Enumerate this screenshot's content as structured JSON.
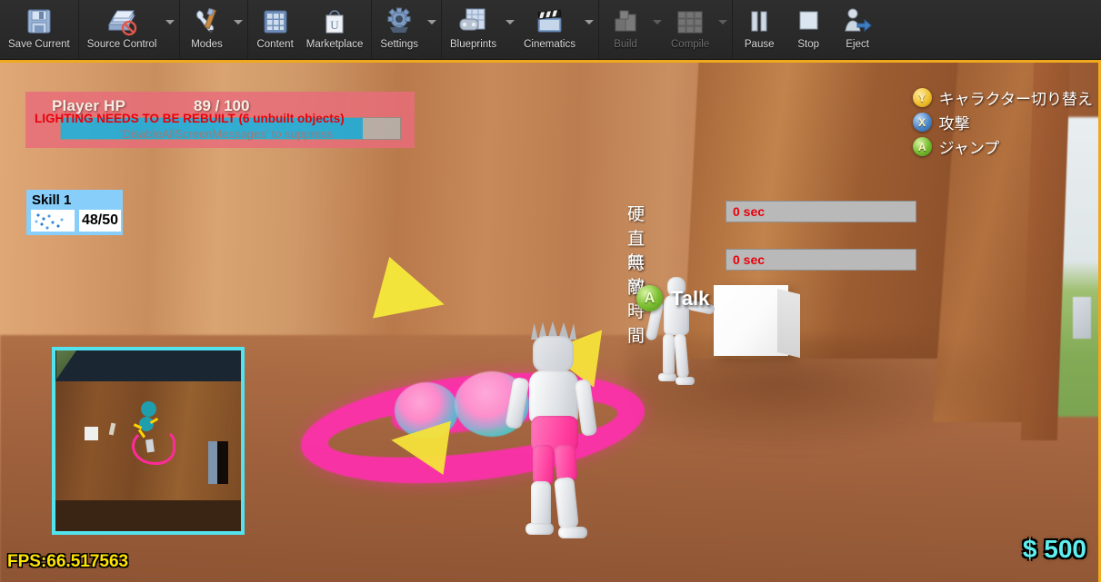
{
  "toolbar": {
    "groups": [
      {
        "name": "file",
        "buttons": [
          {
            "label": "Save Current",
            "icon": "floppy-disk-icon",
            "caret": false,
            "disabled": false
          }
        ]
      },
      {
        "name": "source-control",
        "buttons": [
          {
            "label": "Source Control",
            "icon": "source-control-icon",
            "caret": true,
            "disabled": false
          }
        ]
      },
      {
        "name": "modes",
        "buttons": [
          {
            "label": "Modes",
            "icon": "wrench-pencil-icon",
            "caret": true,
            "disabled": false
          }
        ]
      },
      {
        "name": "content-browser",
        "buttons": [
          {
            "label": "Content",
            "icon": "content-grid-icon",
            "caret": false,
            "disabled": false
          },
          {
            "label": "Marketplace",
            "icon": "marketplace-bag-icon",
            "caret": false,
            "disabled": false
          }
        ]
      },
      {
        "name": "settings",
        "buttons": [
          {
            "label": "Settings",
            "icon": "gear-icon",
            "caret": true,
            "disabled": false
          }
        ]
      },
      {
        "name": "blueprints-cinematics",
        "buttons": [
          {
            "label": "Blueprints",
            "icon": "blueprint-gamepad-icon",
            "caret": true,
            "disabled": false
          },
          {
            "label": "Cinematics",
            "icon": "clapperboard-icon",
            "caret": true,
            "disabled": false
          }
        ]
      },
      {
        "name": "build-compile",
        "buttons": [
          {
            "label": "Build",
            "icon": "build-blocks-icon",
            "caret": true,
            "disabled": true
          },
          {
            "label": "Compile",
            "icon": "compile-cubes-icon",
            "caret": true,
            "disabled": true
          }
        ]
      },
      {
        "name": "play-controls",
        "buttons": [
          {
            "label": "Pause",
            "icon": "pause-icon",
            "caret": false,
            "disabled": false
          },
          {
            "label": "Stop",
            "icon": "stop-icon",
            "caret": false,
            "disabled": false
          },
          {
            "label": "Eject",
            "icon": "eject-person-icon",
            "caret": false,
            "disabled": false
          }
        ]
      }
    ]
  },
  "hud": {
    "player_hp": {
      "title": "Player HP",
      "value_text": "89 / 100",
      "current": 89,
      "max": 100,
      "fill_percent": 89,
      "fill_color": "#0fb0e8",
      "panel_color": "#e96c7b"
    },
    "warning": {
      "line1": "LIGHTING NEEDS TO BE REBUILT (6 unbuilt objects)",
      "line2": "'DisableAllScreenMessages' to suppress",
      "line1_color": "#e8000b"
    },
    "skill": {
      "title": "Skill 1",
      "count_text": "48/50",
      "current": 48,
      "max": 50,
      "icon": "skill-sparkle-icon",
      "panel_color": "#87cefa"
    },
    "gamepad_actions": [
      {
        "button": "Y",
        "label": "キャラクター切り替え",
        "color": "#f0c030"
      },
      {
        "button": "X",
        "label": "攻撃",
        "color": "#4c86c8"
      },
      {
        "button": "A",
        "label": "ジャンプ",
        "color": "#74bb2e"
      }
    ],
    "timers": [
      {
        "label": "硬直時間",
        "value": "0 sec"
      },
      {
        "label": "無敵時間",
        "value": "0 sec"
      }
    ],
    "interact_prompt": {
      "button": "A",
      "label": "Talk",
      "color": "#7ec234"
    },
    "minimap": {
      "name": "minimap",
      "border_color": "#52e3ef"
    },
    "fps": {
      "text": "FPS:66.517563",
      "color": "#ffe400"
    },
    "money": {
      "text": "$ 500",
      "amount": 500,
      "color": "#5ef0ef"
    }
  }
}
